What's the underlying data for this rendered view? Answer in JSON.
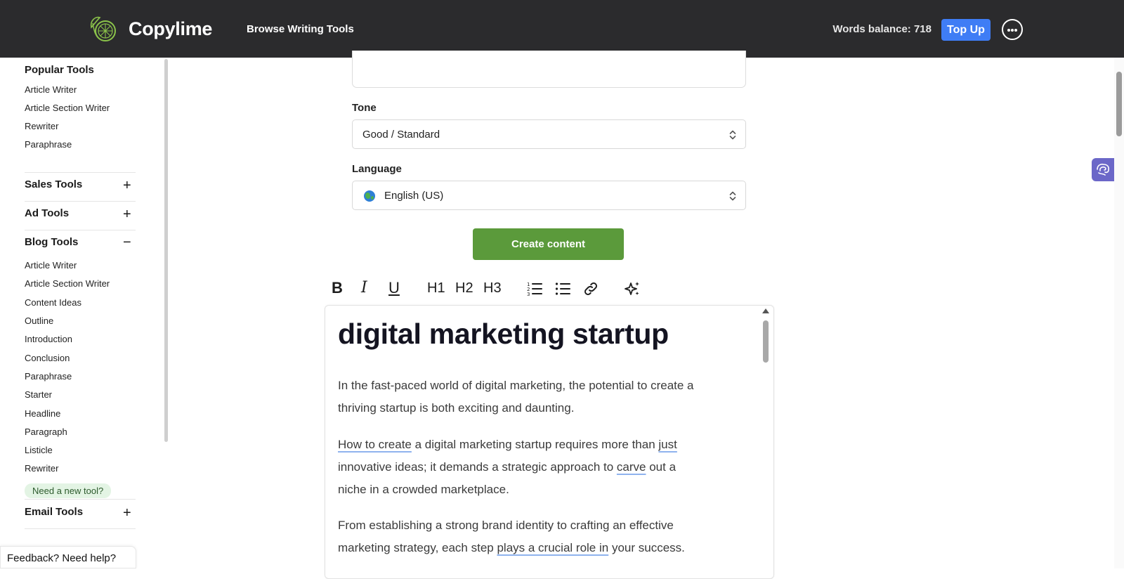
{
  "header": {
    "brand": "Copylime",
    "browse_label": "Browse Writing Tools",
    "words_balance": "Words balance: 718",
    "topup_label": "Top Up"
  },
  "sidebar": {
    "popular_title": "Popular Tools",
    "popular_items": [
      "Article Writer",
      "Article Section Writer",
      "Rewriter",
      "Paraphrase"
    ],
    "sales_title": "Sales Tools",
    "ad_title": "Ad Tools",
    "blog_title": "Blog Tools",
    "blog_items": [
      "Article Writer",
      "Article Section Writer",
      "Content Ideas",
      "Outline",
      "Introduction",
      "Conclusion",
      "Paraphrase",
      "Starter",
      "Headline",
      "Paragraph",
      "Listicle",
      "Rewriter"
    ],
    "need_tool_label": "Need a new tool?",
    "email_title": "Email Tools",
    "feedback_label": "Feedback? Need help?"
  },
  "form": {
    "tone_label": "Tone",
    "tone_value": "Good / Standard",
    "language_label": "Language",
    "language_value": "English (US)",
    "create_label": "Create content"
  },
  "toolbar": {
    "bold": "B",
    "italic": "I",
    "underline": "U",
    "h1": "H1",
    "h2": "H2",
    "h3": "H3"
  },
  "editor": {
    "title": "digital marketing startup",
    "p1_line1": "In the fast-paced world of digital marketing, the potential to create a",
    "p1_line2": "thriving startup is both exciting and daunting.",
    "p2_a": "How to create",
    "p2_b": " a digital marketing startup requires more than ",
    "p2_c": "just",
    "p2_d": "innovative ideas; it demands a strategic approach to ",
    "p2_e": "carve",
    "p2_f": " out a",
    "p2_g": "niche in a crowded marketplace.",
    "p3_line1": "From establishing a strong brand identity to crafting an effective",
    "p3_a": "marketing strategy, each step ",
    "p3_b": "plays a crucial role in",
    "p3_c": " your success."
  },
  "colors": {
    "header_bg": "#2b2b2d",
    "topup_bg": "#3f7df5",
    "create_btn": "#5b9a3b",
    "need_tool_bg": "#e3f4e4",
    "widget": "#6b67c8"
  },
  "icons": [
    "lime-logo-icon",
    "more-options-icon",
    "plus-icon",
    "minus-icon",
    "chevron-updown-icon",
    "globe-icon",
    "ordered-list-icon",
    "bullet-list-icon",
    "link-icon",
    "sparkle-ai-icon",
    "brain-widget-icon"
  ]
}
